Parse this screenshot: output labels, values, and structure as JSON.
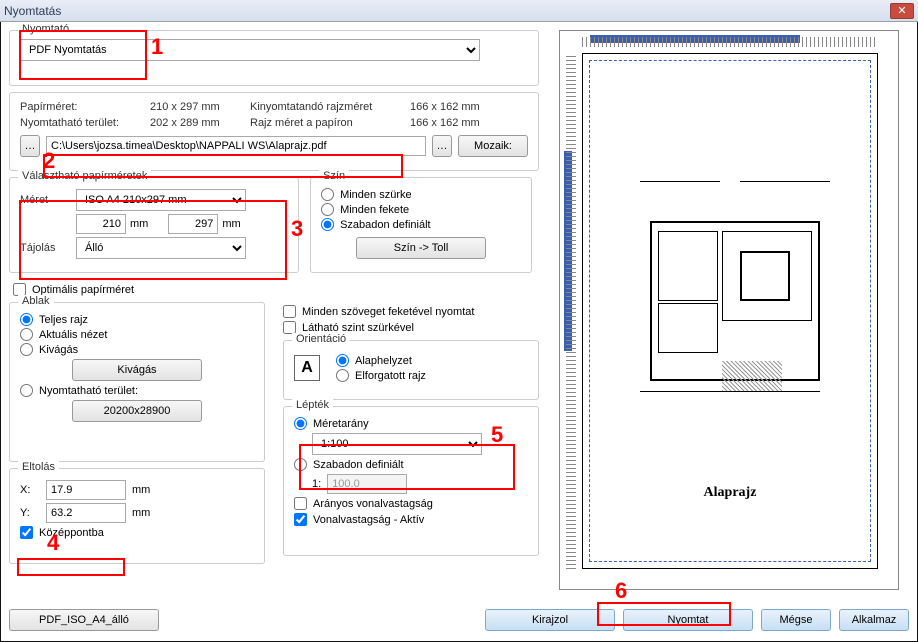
{
  "window": {
    "title": "Nyomtatás"
  },
  "printer": {
    "legend": "Nyomtató",
    "selected": "PDF Nyomtatás"
  },
  "info": {
    "paper_size_label": "Papírméret:",
    "paper_size_value": "210 x 297 mm",
    "plot_size_label": "Kinyomtatandó rajzméret",
    "plot_size_value": "166 x 162 mm",
    "printable_label": "Nyomtatható terület:",
    "printable_value": "202 x 289 mm",
    "paper_size2_label": "Rajz méret a papíron",
    "paper_size2_value": "166 x 162 mm"
  },
  "path": {
    "value": "C:\\Users\\jozsa.timea\\Desktop\\NAPPALI WS\\Alaprajz.pdf",
    "mosaic": "Mozaik:"
  },
  "papers": {
    "legend": "Választható papírméretek",
    "size_label": "Méret",
    "size_value": "ISO A4 210x297 mm",
    "w": "210",
    "w_unit": "mm",
    "h": "297",
    "h_unit": "mm",
    "orient_label": "Tájolás",
    "orient_value": "Álló",
    "optimal": "Optimális papírméret"
  },
  "color": {
    "legend": "Szín",
    "all_grey": "Minden szürke",
    "all_black": "Minden fekete",
    "free": "Szabadon definiált",
    "btn": "Szín -> Toll"
  },
  "window_group": {
    "legend": "Ablak",
    "full": "Teljes rajz",
    "view": "Aktuális nézet",
    "clip": "Kivágás",
    "clip_btn": "Kivágás",
    "printable": "Nyomtatható terület:",
    "area_btn": "20200x28900"
  },
  "text_opts": {
    "black_text": "Minden szöveget feketével nyomtat",
    "grey_layer": "Látható szint szürkével"
  },
  "orient": {
    "legend": "Orientáció",
    "icon": "A",
    "default": "Alaphelyzet",
    "rotated": "Elforgatott rajz"
  },
  "scale": {
    "legend": "Lépték",
    "ratio": "Méretarány",
    "ratio_value": "1:100",
    "free": "Szabadon definiált",
    "one": "1:",
    "one_value": "100.0",
    "proportional": "Arányos vonalvastagság",
    "active": "Vonalvastagság - Aktív"
  },
  "offset": {
    "legend": "Eltolás",
    "x": "X:",
    "x_value": "17.9",
    "y": "Y:",
    "y_value": "63.2",
    "unit": "mm",
    "center": "Középpontba"
  },
  "preview": {
    "title": "Alaprajz"
  },
  "buttons": {
    "preset": "PDF_ISO_A4_álló",
    "draw": "Kirajzol",
    "print": "Nyomtat",
    "cancel": "Mégse",
    "apply": "Alkalmaz"
  },
  "annotations": {
    "n1": "1",
    "n2": "2",
    "n3": "3",
    "n4": "4",
    "n5": "5",
    "n6": "6"
  }
}
